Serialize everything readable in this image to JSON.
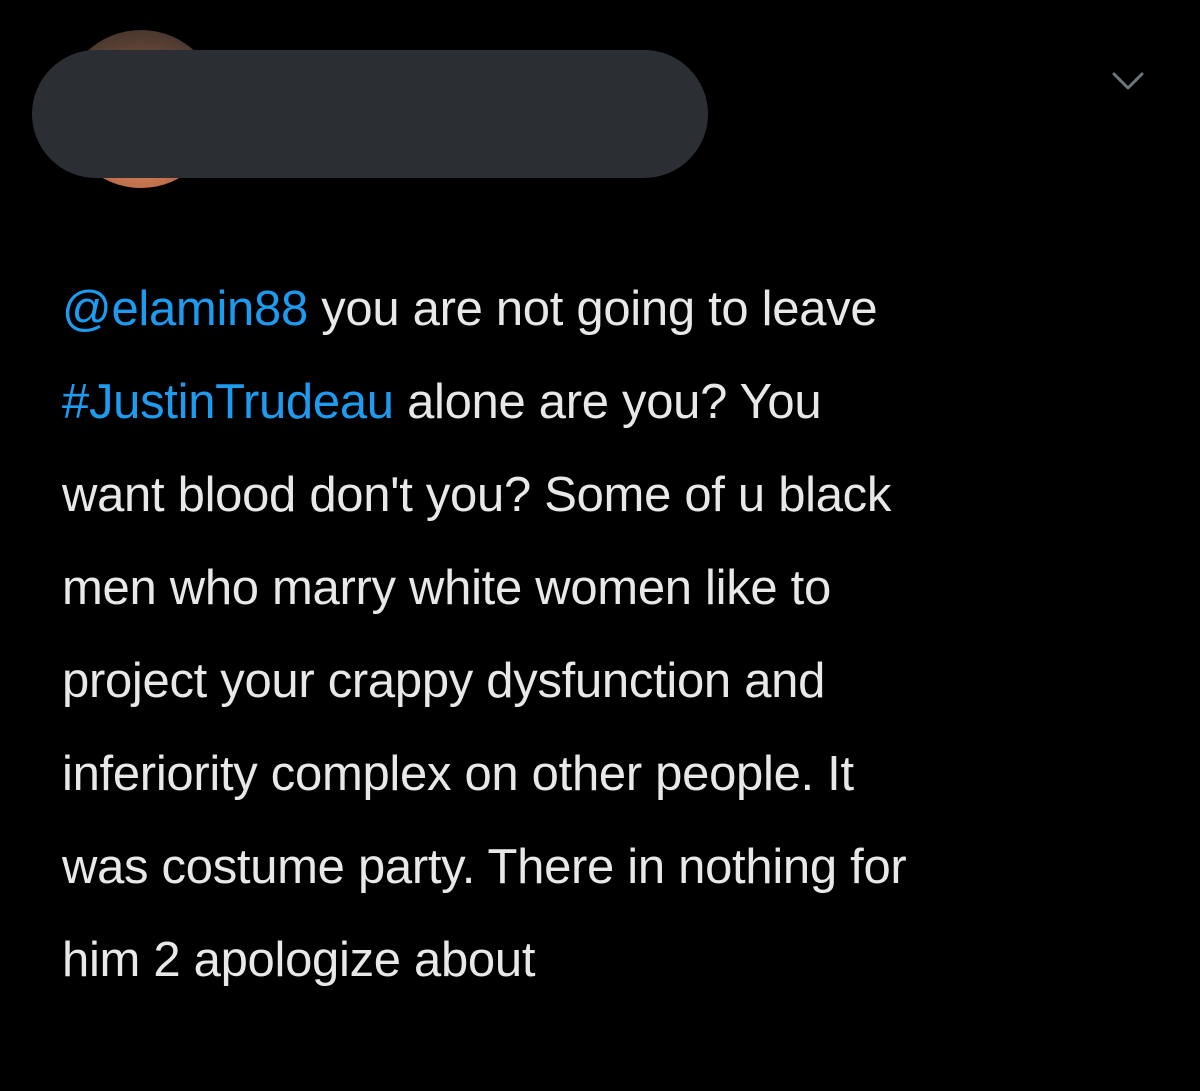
{
  "tweet": {
    "author": {
      "name_redacted": true
    },
    "text": {
      "mention": "@elamin88",
      "part1": " you are not going to leave\n",
      "hashtag": "#JustinTrudeau",
      "part2": " alone are you? You\nwant blood don't you? Some of u black\nmen who marry white women like to\nproject your crappy dysfunction and\ninferiority complex on other people. It\nwas costume party. There in nothing for\nhim 2 apologize about"
    },
    "menu_icon": "chevron-down-icon"
  },
  "colors": {
    "background": "#000000",
    "text": "#e8e8e8",
    "link": "#1d9bf0",
    "redaction": "#2b2f34",
    "chevron": "#6e767d"
  }
}
